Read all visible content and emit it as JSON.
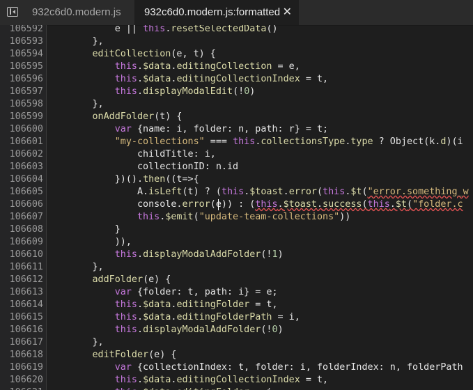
{
  "tabs": [
    {
      "label": "932c6d0.modern.js",
      "active": false
    },
    {
      "label": "932c6d0.modern.js:formatted",
      "active": true
    }
  ],
  "close_glyph": "✕",
  "sidebar_icon": "sidebar-toggle-icon",
  "colors": {
    "background": "#1e1e1e",
    "gutter": "#252526",
    "keyword": "#c678dd",
    "function": "#dcdcaa",
    "string": "#d7ba7d",
    "number": "#b5cea8",
    "text": "#e6e6e6",
    "error_underline": "#e05252"
  },
  "lines": [
    {
      "n": "106592",
      "tokens": [
        {
          "t": "            e || ",
          "c": "plain"
        },
        {
          "t": "this",
          "c": "kw"
        },
        {
          "t": ".",
          "c": "plain"
        },
        {
          "t": "resetSelectedData",
          "c": "fn"
        },
        {
          "t": "()",
          "c": "plain"
        }
      ]
    },
    {
      "n": "106593",
      "tokens": [
        {
          "t": "        },",
          "c": "plain"
        }
      ]
    },
    {
      "n": "106594",
      "tokens": [
        {
          "t": "        ",
          "c": "plain"
        },
        {
          "t": "editCollection",
          "c": "fn"
        },
        {
          "t": "(e, t) {",
          "c": "plain"
        }
      ]
    },
    {
      "n": "106595",
      "tokens": [
        {
          "t": "            ",
          "c": "plain"
        },
        {
          "t": "this",
          "c": "kw"
        },
        {
          "t": ".",
          "c": "plain"
        },
        {
          "t": "$data",
          "c": "fn"
        },
        {
          "t": ".",
          "c": "plain"
        },
        {
          "t": "editingCollection",
          "c": "fn"
        },
        {
          "t": " = e,",
          "c": "plain"
        }
      ]
    },
    {
      "n": "106596",
      "tokens": [
        {
          "t": "            ",
          "c": "plain"
        },
        {
          "t": "this",
          "c": "kw"
        },
        {
          "t": ".",
          "c": "plain"
        },
        {
          "t": "$data",
          "c": "fn"
        },
        {
          "t": ".",
          "c": "plain"
        },
        {
          "t": "editingCollectionIndex",
          "c": "fn"
        },
        {
          "t": " = t,",
          "c": "plain"
        }
      ]
    },
    {
      "n": "106597",
      "tokens": [
        {
          "t": "            ",
          "c": "plain"
        },
        {
          "t": "this",
          "c": "kw"
        },
        {
          "t": ".",
          "c": "plain"
        },
        {
          "t": "displayModalEdit",
          "c": "fn"
        },
        {
          "t": "(!",
          "c": "plain"
        },
        {
          "t": "0",
          "c": "num"
        },
        {
          "t": ")",
          "c": "plain"
        }
      ]
    },
    {
      "n": "106598",
      "tokens": [
        {
          "t": "        },",
          "c": "plain"
        }
      ]
    },
    {
      "n": "106599",
      "tokens": [
        {
          "t": "        ",
          "c": "plain"
        },
        {
          "t": "onAddFolder",
          "c": "fn"
        },
        {
          "t": "(t) {",
          "c": "plain"
        }
      ]
    },
    {
      "n": "106600",
      "tokens": [
        {
          "t": "            ",
          "c": "plain"
        },
        {
          "t": "var",
          "c": "kw"
        },
        {
          "t": " {name: i, folder: n, path: r} = t;",
          "c": "plain"
        }
      ]
    },
    {
      "n": "106601",
      "tokens": [
        {
          "t": "            ",
          "c": "plain"
        },
        {
          "t": "\"my-collections\"",
          "c": "str"
        },
        {
          "t": " === ",
          "c": "plain"
        },
        {
          "t": "this",
          "c": "kw"
        },
        {
          "t": ".",
          "c": "plain"
        },
        {
          "t": "collectionsType",
          "c": "fn"
        },
        {
          "t": ".",
          "c": "plain"
        },
        {
          "t": "type",
          "c": "fn"
        },
        {
          "t": " ? Object(k.",
          "c": "plain"
        },
        {
          "t": "d",
          "c": "fn"
        },
        {
          "t": ")(i",
          "c": "plain"
        }
      ]
    },
    {
      "n": "106602",
      "tokens": [
        {
          "t": "                childTitle: i,",
          "c": "plain"
        }
      ]
    },
    {
      "n": "106603",
      "tokens": [
        {
          "t": "                collectionID: n.id",
          "c": "plain"
        }
      ]
    },
    {
      "n": "106604",
      "tokens": [
        {
          "t": "            })().",
          "c": "plain"
        },
        {
          "t": "then",
          "c": "fn"
        },
        {
          "t": "((t=>{",
          "c": "plain"
        }
      ]
    },
    {
      "n": "106605",
      "tokens": [
        {
          "t": "                A.",
          "c": "plain"
        },
        {
          "t": "isLeft",
          "c": "fn"
        },
        {
          "t": "(t) ? (",
          "c": "plain"
        },
        {
          "t": "this",
          "c": "kw"
        },
        {
          "t": ".",
          "c": "plain"
        },
        {
          "t": "$toast",
          "c": "fn"
        },
        {
          "t": ".",
          "c": "plain"
        },
        {
          "t": "error",
          "c": "fn"
        },
        {
          "t": "(",
          "c": "plain"
        },
        {
          "t": "this",
          "c": "kw"
        },
        {
          "t": ".",
          "c": "plain"
        },
        {
          "t": "$t",
          "c": "fn"
        },
        {
          "t": "(",
          "c": "plain"
        },
        {
          "t": "\"error.something_w",
          "c": "str err"
        }
      ]
    },
    {
      "n": "106606",
      "tokens": [
        {
          "t": "                console.",
          "c": "plain"
        },
        {
          "t": "error",
          "c": "fn"
        },
        {
          "t": "(e)) : (",
          "c": "plain"
        },
        {
          "t": "this",
          "c": "kw err"
        },
        {
          "t": ".",
          "c": "plain err"
        },
        {
          "t": "$toast",
          "c": "fn err"
        },
        {
          "t": ".",
          "c": "plain err"
        },
        {
          "t": "success",
          "c": "fn err"
        },
        {
          "t": "(",
          "c": "plain err"
        },
        {
          "t": "this",
          "c": "kw err"
        },
        {
          "t": ".",
          "c": "plain err"
        },
        {
          "t": "$t",
          "c": "fn err"
        },
        {
          "t": "(",
          "c": "plain err"
        },
        {
          "t": "\"folder.c",
          "c": "str err"
        }
      ]
    },
    {
      "n": "106607",
      "tokens": [
        {
          "t": "                ",
          "c": "plain"
        },
        {
          "t": "this",
          "c": "kw"
        },
        {
          "t": ".",
          "c": "plain"
        },
        {
          "t": "$emit",
          "c": "fn"
        },
        {
          "t": "(",
          "c": "plain"
        },
        {
          "t": "\"update-team-collections\"",
          "c": "str"
        },
        {
          "t": "))",
          "c": "plain"
        }
      ]
    },
    {
      "n": "106608",
      "tokens": [
        {
          "t": "            }",
          "c": "plain"
        }
      ]
    },
    {
      "n": "106609",
      "tokens": [
        {
          "t": "            )),",
          "c": "plain"
        }
      ]
    },
    {
      "n": "106610",
      "tokens": [
        {
          "t": "            ",
          "c": "plain"
        },
        {
          "t": "this",
          "c": "kw"
        },
        {
          "t": ".",
          "c": "plain"
        },
        {
          "t": "displayModalAddFolder",
          "c": "fn"
        },
        {
          "t": "(!",
          "c": "plain"
        },
        {
          "t": "1",
          "c": "num"
        },
        {
          "t": ")",
          "c": "plain"
        }
      ]
    },
    {
      "n": "106611",
      "tokens": [
        {
          "t": "        },",
          "c": "plain"
        }
      ]
    },
    {
      "n": "106612",
      "tokens": [
        {
          "t": "        ",
          "c": "plain"
        },
        {
          "t": "addFolder",
          "c": "fn"
        },
        {
          "t": "(e) {",
          "c": "plain"
        }
      ]
    },
    {
      "n": "106613",
      "tokens": [
        {
          "t": "            ",
          "c": "plain"
        },
        {
          "t": "var",
          "c": "kw"
        },
        {
          "t": " {folder: t, path: i} = e;",
          "c": "plain"
        }
      ]
    },
    {
      "n": "106614",
      "tokens": [
        {
          "t": "            ",
          "c": "plain"
        },
        {
          "t": "this",
          "c": "kw"
        },
        {
          "t": ".",
          "c": "plain"
        },
        {
          "t": "$data",
          "c": "fn"
        },
        {
          "t": ".",
          "c": "plain"
        },
        {
          "t": "editingFolder",
          "c": "fn"
        },
        {
          "t": " = t,",
          "c": "plain"
        }
      ]
    },
    {
      "n": "106615",
      "tokens": [
        {
          "t": "            ",
          "c": "plain"
        },
        {
          "t": "this",
          "c": "kw"
        },
        {
          "t": ".",
          "c": "plain"
        },
        {
          "t": "$data",
          "c": "fn"
        },
        {
          "t": ".",
          "c": "plain"
        },
        {
          "t": "editingFolderPath",
          "c": "fn"
        },
        {
          "t": " = i,",
          "c": "plain"
        }
      ]
    },
    {
      "n": "106616",
      "tokens": [
        {
          "t": "            ",
          "c": "plain"
        },
        {
          "t": "this",
          "c": "kw"
        },
        {
          "t": ".",
          "c": "plain"
        },
        {
          "t": "displayModalAddFolder",
          "c": "fn"
        },
        {
          "t": "(!",
          "c": "plain"
        },
        {
          "t": "0",
          "c": "num"
        },
        {
          "t": ")",
          "c": "plain"
        }
      ]
    },
    {
      "n": "106617",
      "tokens": [
        {
          "t": "        },",
          "c": "plain"
        }
      ]
    },
    {
      "n": "106618",
      "tokens": [
        {
          "t": "        ",
          "c": "plain"
        },
        {
          "t": "editFolder",
          "c": "fn"
        },
        {
          "t": "(e) {",
          "c": "plain"
        }
      ]
    },
    {
      "n": "106619",
      "tokens": [
        {
          "t": "            ",
          "c": "plain"
        },
        {
          "t": "var",
          "c": "kw"
        },
        {
          "t": " {collectionIndex: t, folder: i, folderIndex: n, folderPath",
          "c": "plain"
        }
      ]
    },
    {
      "n": "106620",
      "tokens": [
        {
          "t": "            ",
          "c": "plain"
        },
        {
          "t": "this",
          "c": "kw"
        },
        {
          "t": ".",
          "c": "plain"
        },
        {
          "t": "$data",
          "c": "fn"
        },
        {
          "t": ".",
          "c": "plain"
        },
        {
          "t": "editingCollectionIndex",
          "c": "fn"
        },
        {
          "t": " = t,",
          "c": "plain"
        }
      ]
    },
    {
      "n": "106621",
      "tokens": [
        {
          "t": "            ",
          "c": "plain"
        },
        {
          "t": "this",
          "c": "kw"
        },
        {
          "t": ".",
          "c": "plain"
        },
        {
          "t": "$data",
          "c": "fn"
        },
        {
          "t": ".",
          "c": "plain"
        },
        {
          "t": "editingFolder",
          "c": "fn"
        },
        {
          "t": " = i,",
          "c": "plain"
        }
      ]
    }
  ]
}
